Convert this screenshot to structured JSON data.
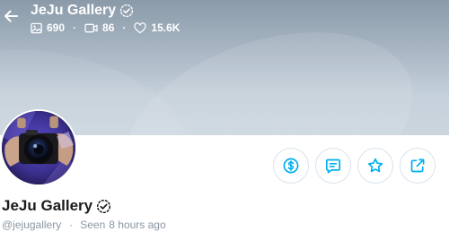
{
  "header": {
    "title": "JeJu Gallery",
    "verified_icon": "verified-badge-icon",
    "back_icon": "arrow-left-icon"
  },
  "stats": {
    "photos": "690",
    "videos": "86",
    "likes": "15.6K",
    "separator": "·"
  },
  "profile": {
    "name": "JeJu Gallery",
    "handle": "@jejugallery",
    "separator": "·",
    "seen_label": "Seen",
    "seen_time": "8 hours ago",
    "avatar_icon": "avatar-camera-photo"
  },
  "actions": [
    {
      "icon": "dollar-circle-icon"
    },
    {
      "icon": "message-icon"
    },
    {
      "icon": "star-icon"
    },
    {
      "icon": "share-icon"
    }
  ],
  "colors": {
    "accent": "#00aff0",
    "text_primary": "#1b1b1b",
    "text_muted": "#8a96a3",
    "button_border": "#d9e3ec",
    "banner_top": "#8a9aa8",
    "banner_bottom": "#ccd6df"
  }
}
